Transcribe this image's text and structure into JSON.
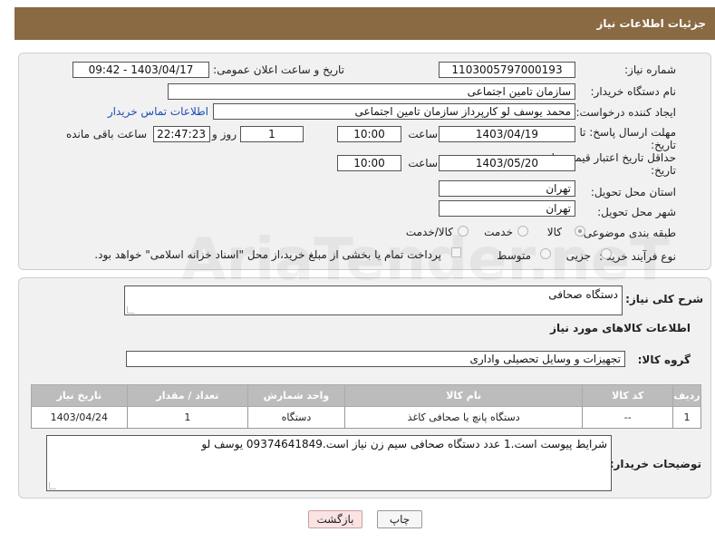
{
  "header": {
    "title": "جزئیات اطلاعات نیاز"
  },
  "form": {
    "need_number_label": "شماره نیاز:",
    "need_number": "1103005797000193",
    "announce_label": "تاریخ و ساعت اعلان عمومی:",
    "announce_value": "1403/04/17 - 09:42",
    "buyer_org_label": "نام دستگاه خریدار:",
    "buyer_org": "سازمان تامین اجتماعی",
    "creator_label": "ایجاد کننده درخواست:",
    "creator": "محمد یوسف لو کارپرداز سازمان تامین اجتماعی",
    "contact_link": "اطلاعات تماس خریدار",
    "reply_deadline_label_1": "مهلت ارسال پاسخ: تا",
    "reply_deadline_label_2": "تاریخ:",
    "reply_date": "1403/04/19",
    "time_label": "ساعت",
    "reply_time": "10:00",
    "days_value": "1",
    "days_label": "روز و",
    "remaining_time": "22:47:23",
    "remaining_label": "ساعت باقی مانده",
    "price_validity_label_1": "حداقل تاریخ اعتبار قیمت: تا",
    "price_validity_label_2": "تاریخ:",
    "price_validity_date": "1403/05/20",
    "price_validity_time": "10:00",
    "province_label": "استان محل تحویل:",
    "province": "تهران",
    "city_label": "شهر محل تحویل:",
    "city": "تهران",
    "category_label": "طبقه بندی موضوعی:",
    "category_options": [
      "کالا",
      "خدمت",
      "کالا/خدمت"
    ],
    "process_label": "نوع فرآیند خرید :",
    "process_options": [
      "جزیی",
      "متوسط"
    ],
    "payment_note": "پرداخت تمام یا بخشی از مبلغ خرید،از محل \"اسناد خزانه اسلامی\" خواهد بود."
  },
  "details": {
    "summary_label": "شرح کلی نیاز:",
    "summary": "دستگاه صحافی",
    "goods_info_title": "اطلاعات کالاهای مورد نیاز",
    "group_label": "گروه کالا:",
    "group": "تجهیزات و وسایل تحصیلی واداری",
    "table": {
      "headers": [
        "ردیف",
        "کد کالا",
        "نام کالا",
        "واحد شمارش",
        "تعداد / مقدار",
        "تاریخ نیاز"
      ],
      "rows": [
        [
          "1",
          "--",
          "دستگاه پانچ یا صحافی کاغذ",
          "دستگاه",
          "1",
          "1403/04/24"
        ]
      ]
    },
    "buyer_notes_label": "توضیحات خریدار:",
    "buyer_notes": "شرایط پیوست است.1 عدد دستگاه صحافی سیم زن نیاز است.09374641849 یوسف لو"
  },
  "buttons": {
    "print": "چاپ",
    "back": "بازگشت"
  },
  "watermark": "AriaTender.neT"
}
